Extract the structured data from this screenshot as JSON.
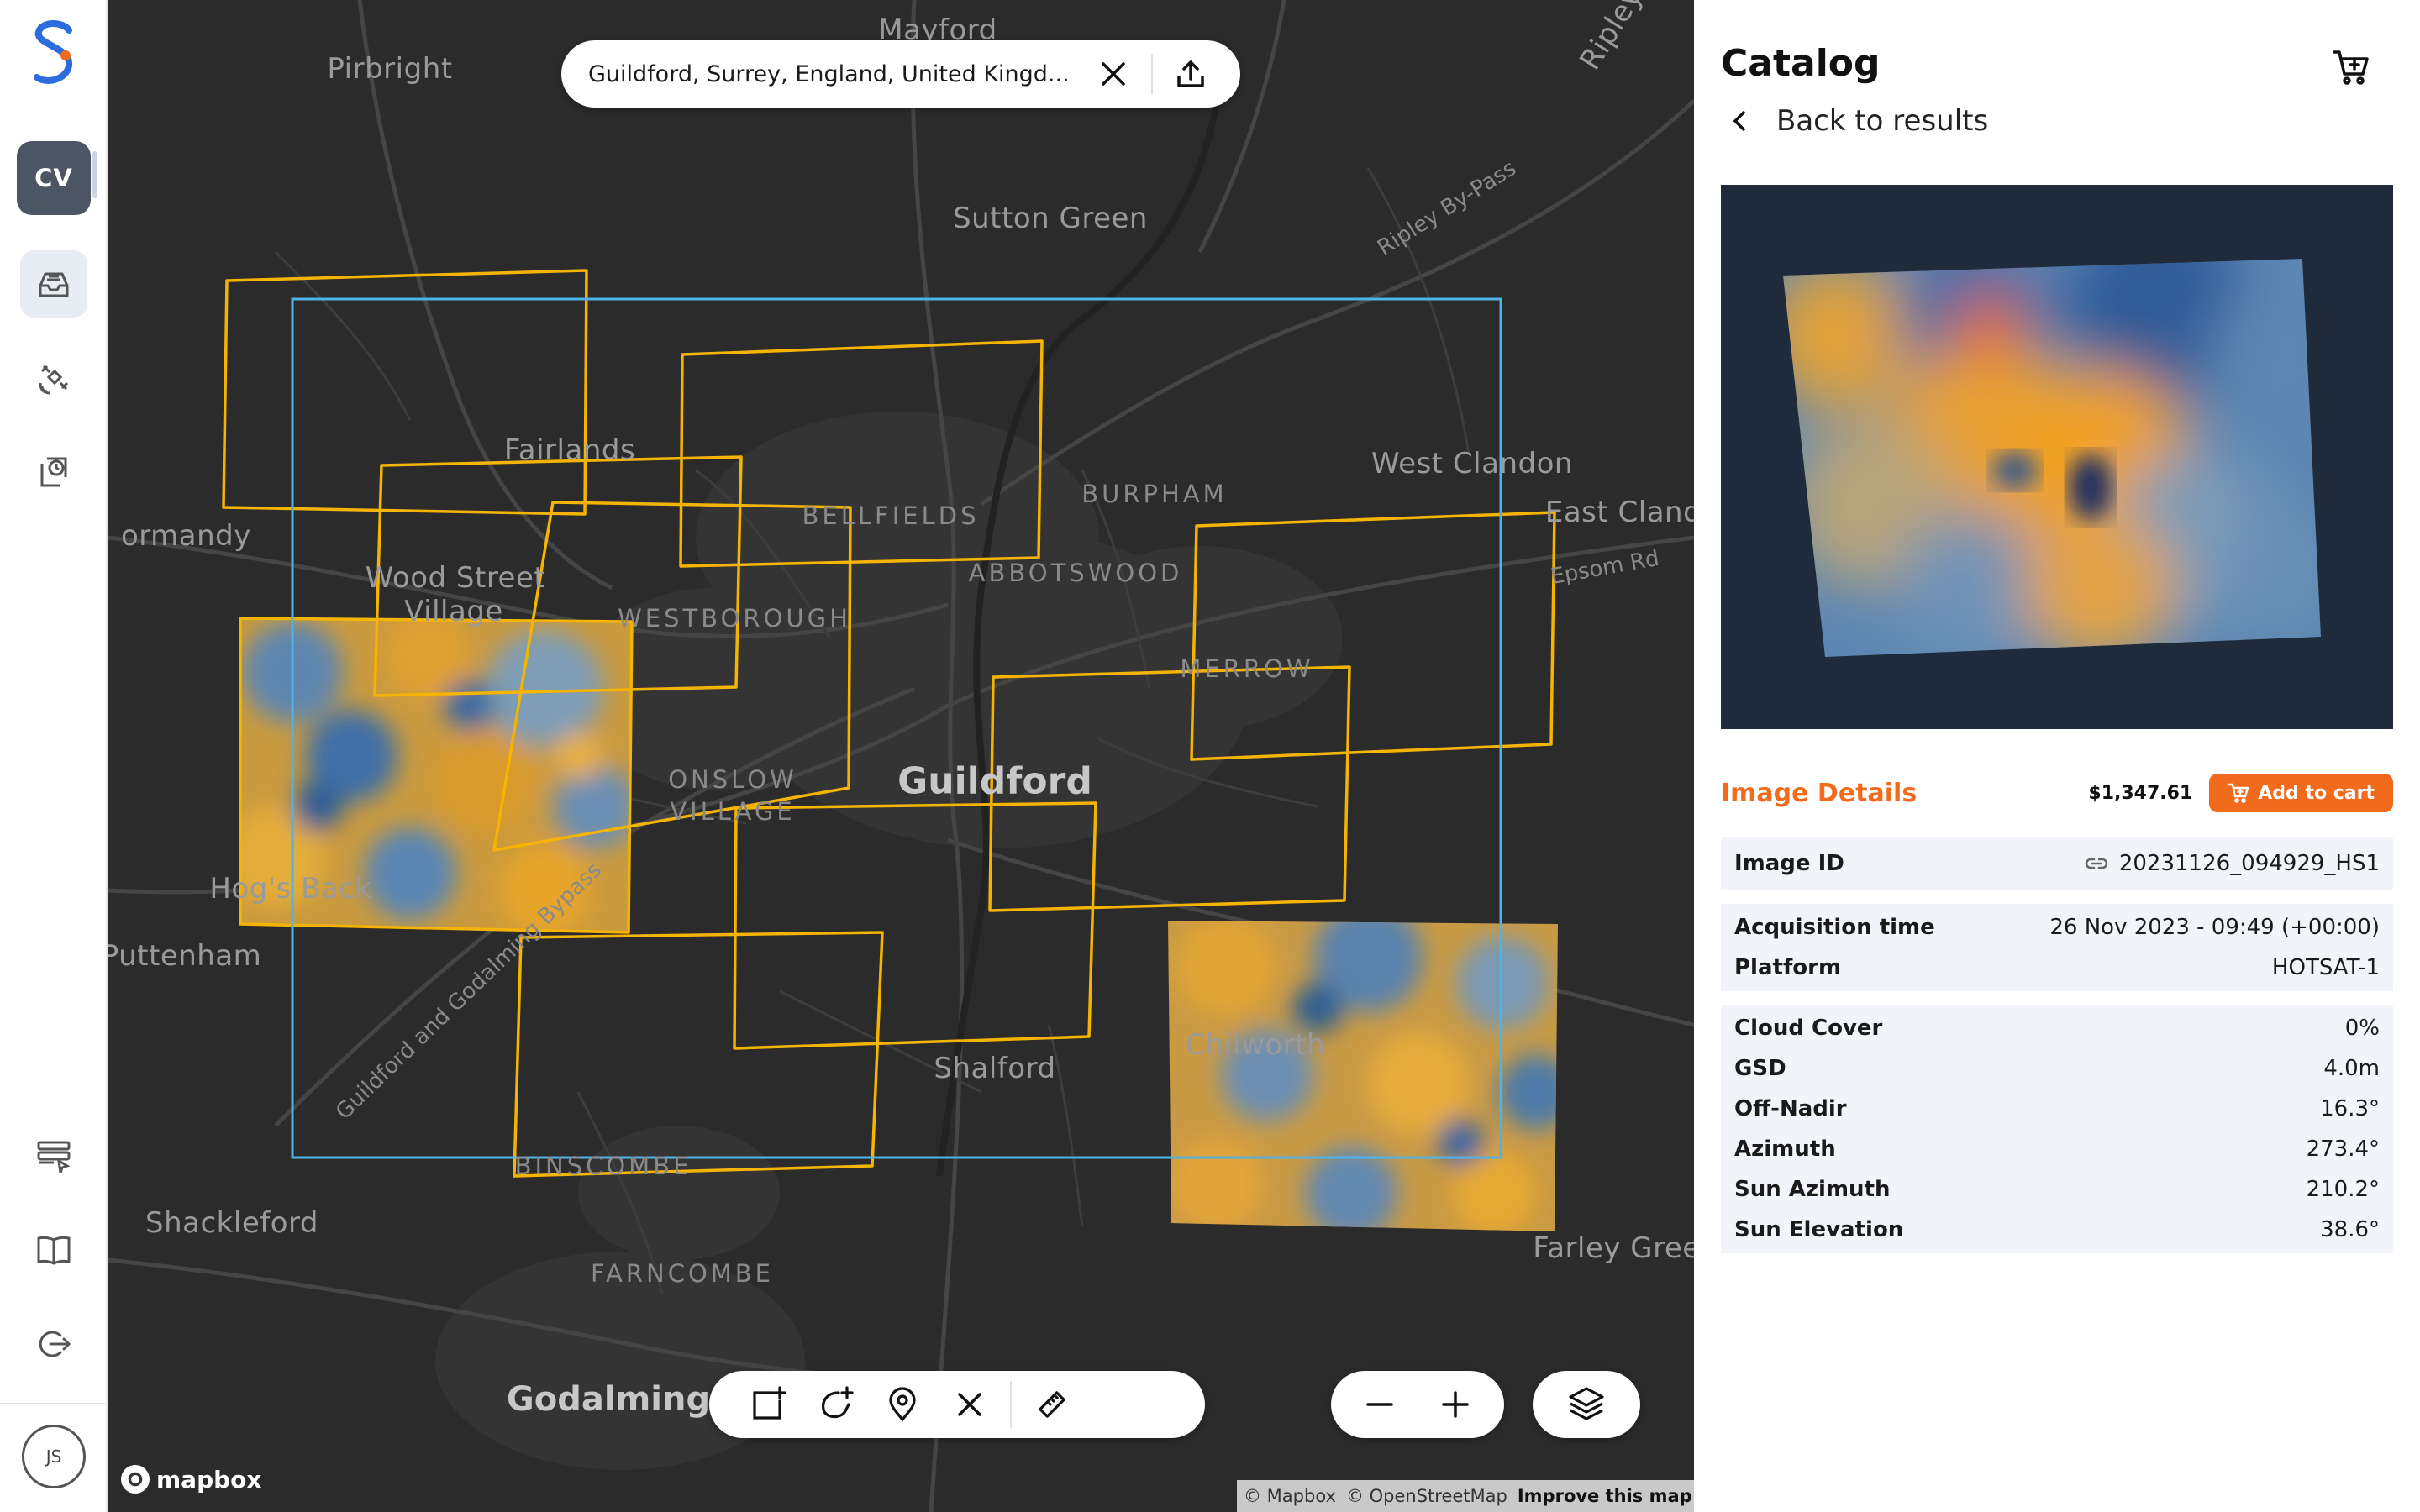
{
  "rail": {
    "logo_icon": "stacked-s-logo-icon",
    "workspace_badge": "CV",
    "nav_icons": [
      "catalog-tray-icon",
      "satellite-icon",
      "history-clock-icon",
      "tasks-list-icon",
      "book-icon",
      "logout-icon"
    ],
    "user_initials": "JS"
  },
  "map": {
    "search_value": "Guildford, Surrey, England, United Kingdom",
    "search_display": "Guildford, Surrey, England, United Kingd...",
    "place_labels": {
      "mayford": "Mayford",
      "pirbright": "Pirbright",
      "ripley": "Ripley",
      "sutton_green": "Sutton Green",
      "ripley_bypass": "Ripley By-Pass",
      "fairlands": "Fairlands",
      "bellfields": "BELLFIELDS",
      "burpham": "BURPHAM",
      "west_clandon": "West Clandon",
      "east_clandon": "East Cland",
      "epsom_rd": "Epsom Rd",
      "normandy": "ormandy",
      "wood_street": "Wood Street",
      "village": "Village",
      "westborough": "WESTBOROUGH",
      "abbotswood": "ABBOTSWOOD",
      "merrow": "MERROW",
      "onslow": "ONSLOW",
      "onslow_village": "VILLAGE",
      "guildford": "Guildford",
      "hogs_back": "Hog's Back",
      "bypass": "Guildford and Godalming Bypass",
      "puttenham": "Puttenham",
      "chilworth": "Chilworth",
      "shalford": "Shalford",
      "binscombe": "BINSCOMBE",
      "shackleford": "Shackleford",
      "farncombe": "FARNCOMBE",
      "farley_green": "Farley Gree",
      "godalming": "Godalming"
    },
    "attribution": {
      "mapbox": "© Mapbox",
      "osm": "© OpenStreetMap",
      "improve": "Improve this map"
    },
    "mapbox_logo_text": "mapbox",
    "colors": {
      "footprint": "#f5b400",
      "aoi": "#4fb3e8",
      "background": "#2b2b2b"
    }
  },
  "panel": {
    "title": "Catalog",
    "back_label": "Back to results",
    "details_title": "Image Details",
    "price": "$1,347.61",
    "add_to_cart": "Add to cart",
    "accent": "#f26b1d",
    "image_id": {
      "label": "Image ID",
      "value": "20231126_094929_HS1"
    },
    "acquisition": [
      {
        "label": "Acquisition time",
        "value": "26 Nov 2023 - 09:49 (+00:00)"
      },
      {
        "label": "Platform",
        "value": "HOTSAT-1"
      }
    ],
    "metrics": [
      {
        "label": "Cloud Cover",
        "value": "0%"
      },
      {
        "label": "GSD",
        "value": "4.0m"
      },
      {
        "label": "Off-Nadir",
        "value": "16.3°"
      },
      {
        "label": "Azimuth",
        "value": "273.4°"
      },
      {
        "label": "Sun Azimuth",
        "value": "210.2°"
      },
      {
        "label": "Sun Elevation",
        "value": "38.6°"
      }
    ]
  }
}
